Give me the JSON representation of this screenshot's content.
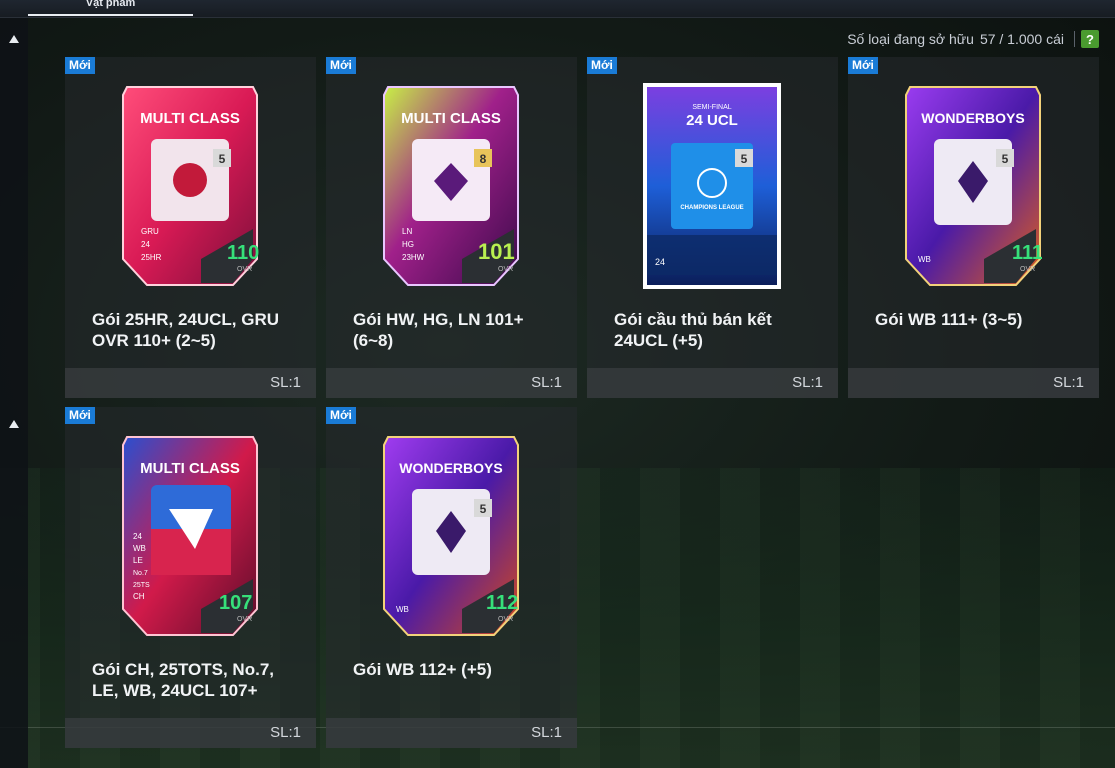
{
  "tabs": {
    "active_label": "Vật phẩm"
  },
  "ownership": {
    "label": "Số loại đang sở hữu",
    "value": "57 / 1.000 cái",
    "help": "?"
  },
  "items": [
    {
      "badge": "Mới",
      "pack_title": "MULTI CLASS",
      "number": "5",
      "tags": [
        "GRU",
        "24",
        "25HR"
      ],
      "ovr": "110",
      "ovr_label": "OVR",
      "name": "Gói 25HR, 24UCL, GRU OVR 110+ (2~5)",
      "qty": "SL:1"
    },
    {
      "badge": "Mới",
      "pack_title": "MULTI CLASS",
      "number": "8",
      "tags": [
        "LN",
        "HG",
        "23HW"
      ],
      "ovr": "101",
      "ovr_label": "OVR",
      "name": "Gói HW, HG, LN 101+ (6~8)",
      "qty": "SL:1"
    },
    {
      "badge": "Mới",
      "pack_title": "24 UCL",
      "pack_subtitle": "SEMI-FINAL",
      "number": "5",
      "tags": [
        "24"
      ],
      "league": "CHAMPIONS LEAGUE",
      "name": "Gói cầu thủ bán kết 24UCL (+5)",
      "qty": "SL:1"
    },
    {
      "badge": "Mới",
      "pack_title": "WONDERBOYS",
      "number": "5",
      "tags": [
        "WB"
      ],
      "ovr": "111",
      "ovr_label": "OVR",
      "name": "Gói WB 111+ (3~5)",
      "qty": "SL:1"
    },
    {
      "badge": "Mới",
      "pack_title": "MULTI CLASS",
      "number": "",
      "tags": [
        "24",
        "WB",
        "LE",
        "No.7",
        "25TS",
        "CH"
      ],
      "ovr": "107",
      "ovr_label": "OVR",
      "name": "Gói CH, 25TOTS, No.7, LE, WB, 24UCL 107+",
      "qty": "SL:1"
    },
    {
      "badge": "Mới",
      "pack_title": "WONDERBOYS",
      "number": "5",
      "tags": [
        "WB"
      ],
      "ovr": "112",
      "ovr_label": "OVR",
      "name": "Gói WB 112+ (+5)",
      "qty": "SL:1"
    }
  ],
  "colors": {
    "accent_new": "#1a7bd6",
    "ovr_green": "#36e07a",
    "help_green": "#4a9b2f"
  }
}
